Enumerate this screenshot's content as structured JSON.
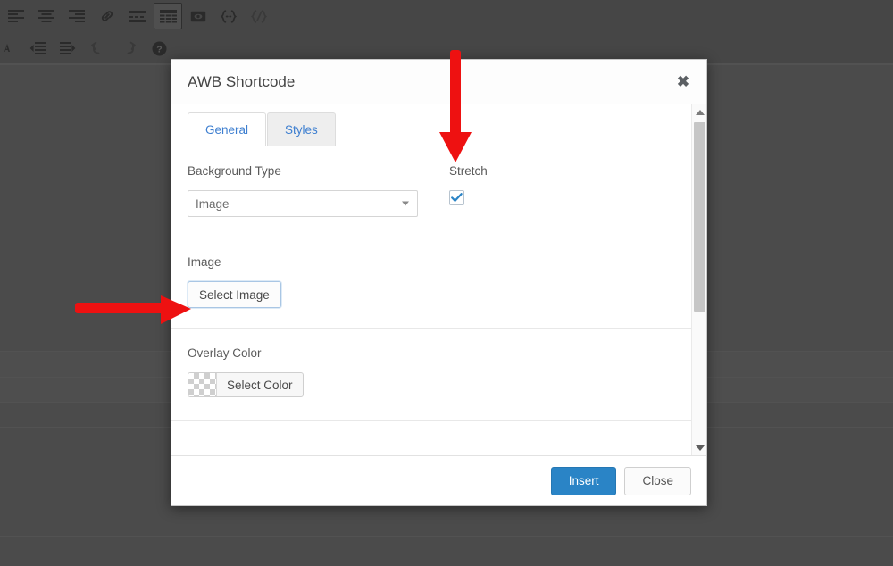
{
  "editor": {
    "toolbar_rows": [
      [
        {
          "name": "align-left-icon",
          "label": "Align left"
        },
        {
          "name": "align-center-icon",
          "label": "Align center"
        },
        {
          "name": "align-right-icon",
          "label": "Align right"
        },
        {
          "name": "link-icon",
          "label": "Insert/edit link"
        },
        {
          "name": "read-more-icon",
          "label": "Insert Read More tag"
        },
        {
          "name": "table-icon",
          "label": "Table",
          "state": "active"
        },
        {
          "name": "page-break-icon",
          "label": "Insert Page Break tag"
        },
        {
          "name": "shortcode-icon",
          "label": "Shortcode"
        },
        {
          "name": "shortcode-disabled-icon",
          "label": "Shortcode",
          "state": "disabled"
        }
      ],
      [
        {
          "name": "text-color-icon",
          "label": "Text color",
          "state": "clipped"
        },
        {
          "name": "outdent-icon",
          "label": "Decrease indent"
        },
        {
          "name": "indent-icon",
          "label": "Increase indent"
        },
        {
          "name": "undo-icon",
          "label": "Undo",
          "state": "disabled"
        },
        {
          "name": "redo-icon",
          "label": "Redo",
          "state": "disabled"
        },
        {
          "name": "help-icon",
          "label": "Keyboard Shortcuts"
        }
      ]
    ]
  },
  "modal": {
    "title": "AWB Shortcode",
    "close_label": "✖",
    "tabs": [
      {
        "label": "General",
        "active": true
      },
      {
        "label": "Styles",
        "active": false
      }
    ],
    "fields": {
      "background_type": {
        "label": "Background Type",
        "value": "Image",
        "options": [
          "Image"
        ]
      },
      "stretch": {
        "label": "Stretch",
        "checked": true
      },
      "image": {
        "label": "Image",
        "button_label": "Select Image"
      },
      "overlay_color": {
        "label": "Overlay Color",
        "button_label": "Select Color",
        "swatch": "transparent"
      }
    },
    "footer": {
      "insert_label": "Insert",
      "close_label": "Close"
    },
    "scrollbar": {
      "up_label": "Scroll up",
      "down_label": "Scroll down",
      "thumb_label": "Scroll thumb"
    }
  },
  "annotations": [
    {
      "name": "arrow-down-to-stretch",
      "direction": "down",
      "color": "#ee1111"
    },
    {
      "name": "arrow-right-to-select-image",
      "direction": "right",
      "color": "#ee1111"
    }
  ]
}
